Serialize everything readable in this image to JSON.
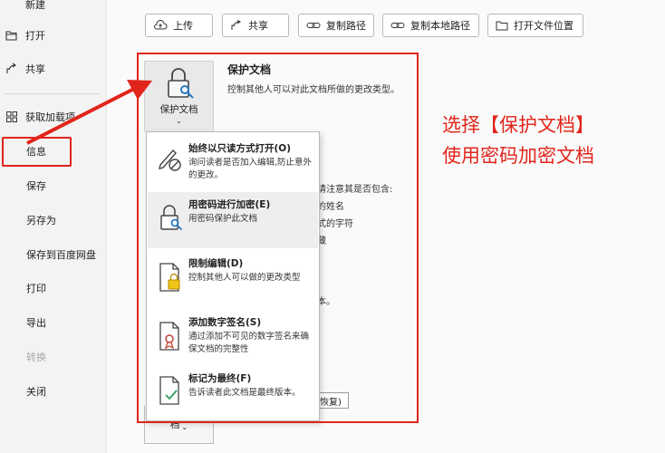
{
  "sidebar": {
    "items": [
      {
        "label": "新建",
        "icon": "new-icon"
      },
      {
        "label": "打开",
        "icon": "folder-open-icon"
      },
      {
        "label": "共享",
        "icon": "share-icon"
      },
      {
        "label": "获取加载项",
        "icon": "addins-icon"
      },
      {
        "label": "信息"
      },
      {
        "label": "保存"
      },
      {
        "label": "另存为"
      },
      {
        "label": "保存到百度网盘"
      },
      {
        "label": "打印"
      },
      {
        "label": "导出"
      },
      {
        "label": "转换"
      },
      {
        "label": "关闭"
      }
    ]
  },
  "toolbar": {
    "upload": "上传",
    "share": "共享",
    "copy_path": "复制路径",
    "copy_local_path": "复制本地路径",
    "open_location": "打开文件位置"
  },
  "protect": {
    "button_label": "保护文档",
    "title": "保护文档",
    "description": "控制其他人可以对此文档所做的更改类型。"
  },
  "background": {
    "inspect_partial": "请注意其是否包含:",
    "line1": "的姓名",
    "line2": "式的字符",
    "line3": "藏",
    "line4": "本。",
    "restore": "的恢复)",
    "bottom_button": "档"
  },
  "dropdown": {
    "items": [
      {
        "title": "始终以只读方式打开(O)",
        "desc": "询问读者是否加入编辑,防止意外的更改。",
        "icon": "no-edit-icon"
      },
      {
        "title": "用密码进行加密(E)",
        "desc": "用密码保护此文档",
        "icon": "lock-key-icon"
      },
      {
        "title": "限制编辑(D)",
        "desc": "控制其他人可以做的更改类型",
        "icon": "restrict-edit-icon"
      },
      {
        "title": "添加数字签名(S)",
        "desc": "通过添加不可见的数字签名来确保文档的完整性",
        "icon": "digital-signature-icon"
      },
      {
        "title": "标记为最终(F)",
        "desc": "告诉读者此文档是最终版本。",
        "icon": "mark-final-icon"
      }
    ]
  },
  "annotation": {
    "line1": "选择【保护文档】",
    "line2": "使用密码加密文档"
  },
  "colors": {
    "accent_red": "#e1251b"
  }
}
